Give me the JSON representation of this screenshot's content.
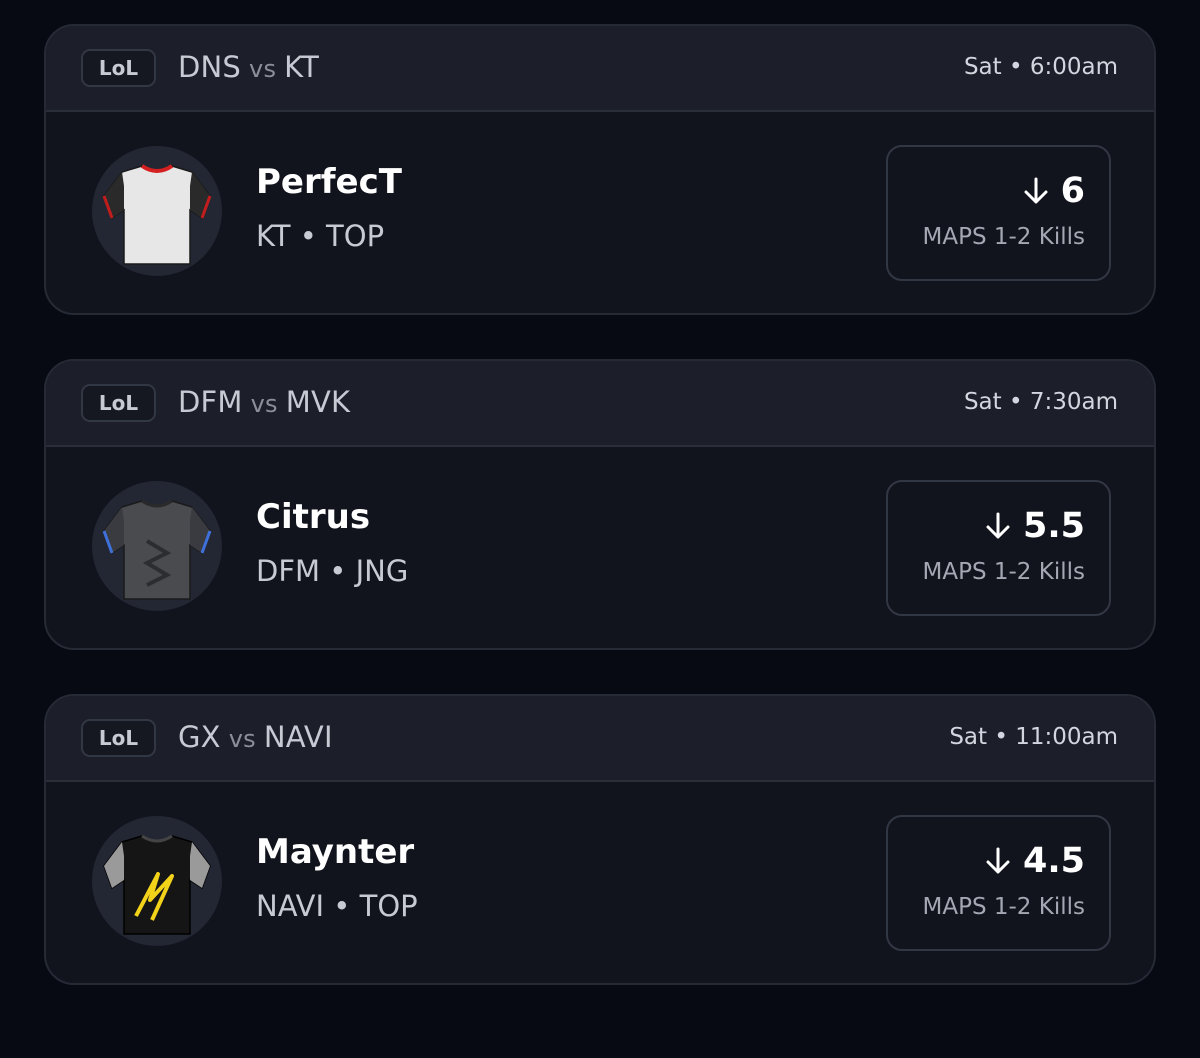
{
  "cards": [
    {
      "league": "LoL",
      "team_a": "DNS",
      "vs": "vs",
      "team_b": "KT",
      "time": "Sat • 6:00am",
      "player": "PerfecT",
      "meta": "KT • TOP",
      "jersey": "white-jersey-icon",
      "direction": "down-arrow-icon",
      "line": "6",
      "stat": "MAPS 1-2 Kills"
    },
    {
      "league": "LoL",
      "team_a": "DFM",
      "vs": "vs",
      "team_b": "MVK",
      "time": "Sat • 7:30am",
      "player": "Citrus",
      "meta": "DFM • JNG",
      "jersey": "grey-jersey-icon",
      "direction": "down-arrow-icon",
      "line": "5.5",
      "stat": "MAPS 1-2 Kills"
    },
    {
      "league": "LoL",
      "team_a": "GX",
      "vs": "vs",
      "team_b": "NAVI",
      "time": "Sat • 11:00am",
      "player": "Maynter",
      "meta": "NAVI • TOP",
      "jersey": "black-yellow-jersey-icon",
      "direction": "down-arrow-icon",
      "line": "4.5",
      "stat": "MAPS 1-2 Kills"
    }
  ],
  "colors": {
    "background": "#070a12",
    "card": "#11141d",
    "header": "#1c1f29",
    "text_primary": "#ffffff",
    "text_secondary": "#c7cad3"
  }
}
